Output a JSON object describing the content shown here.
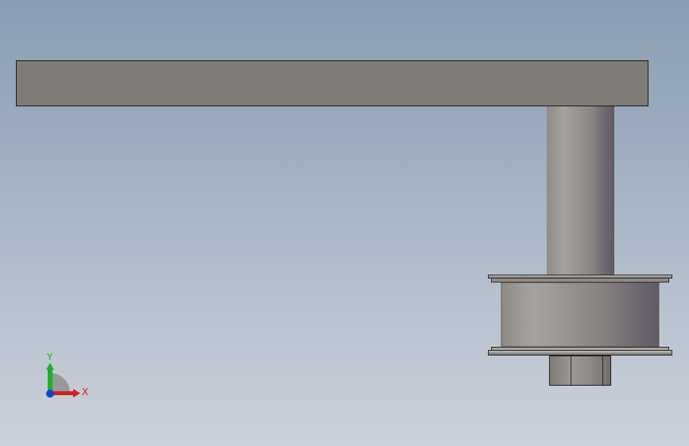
{
  "viewport": {
    "background_top": "#8a9db3",
    "background_bottom": "#c9d0da"
  },
  "triad": {
    "x_label": "X",
    "y_label": "Y",
    "x_color": "#d21f1f",
    "y_color": "#1fae2a",
    "z_color": "#1a3fcc"
  },
  "part_colors": {
    "arm": "#7f7b77",
    "shaft_light": "#a39f9b",
    "shaft_dark": "#6e6670",
    "nut": "#8d8a88",
    "outline": "#1c1c1c"
  }
}
